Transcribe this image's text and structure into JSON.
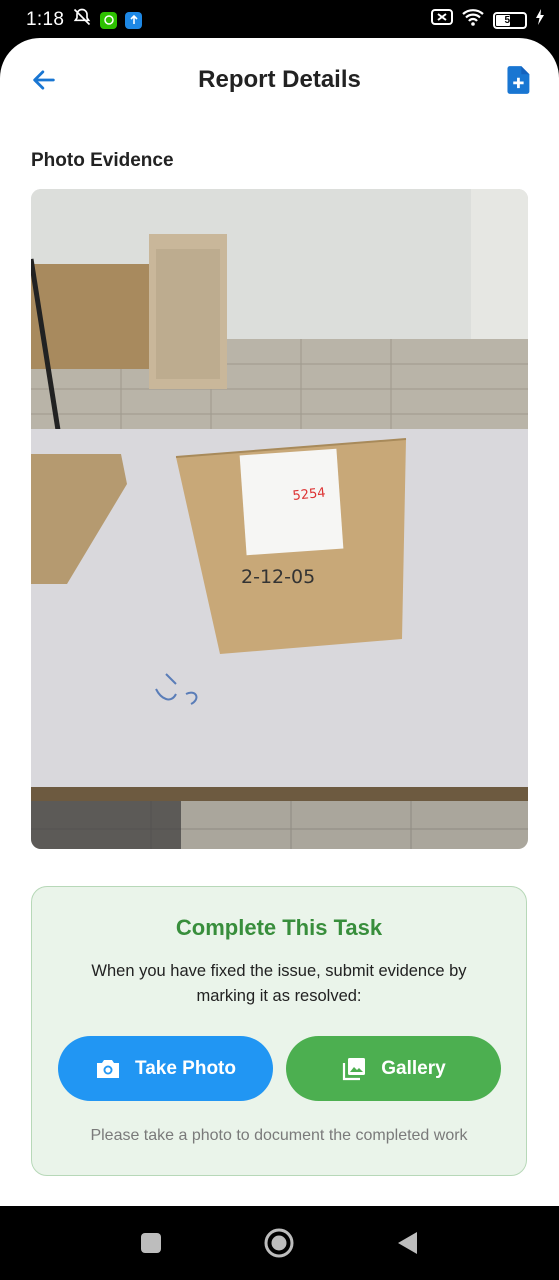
{
  "status_bar": {
    "time": "1:18",
    "battery_level": "50",
    "icons": [
      "mute-alarm-icon",
      "wechat-app-icon",
      "upload-app-icon",
      "sim-x-icon",
      "wifi-icon",
      "battery-icon",
      "charging-icon"
    ]
  },
  "header": {
    "title": "Report Details",
    "back_icon": "arrow-back-icon",
    "action_icon": "add-document-icon"
  },
  "photo_section": {
    "title": "Photo Evidence",
    "photo_label_number": "5254",
    "photo_bag_date": "2-12-05"
  },
  "task_card": {
    "title": "Complete This Task",
    "description": "When you have fixed the issue, submit evidence by marking it as resolved:",
    "take_photo_label": "Take Photo",
    "gallery_label": "Gallery",
    "hint": "Please take a photo to document the completed work"
  },
  "colors": {
    "primary_blue": "#2196f3",
    "success_green": "#4caf50",
    "title_green": "#388e3c",
    "card_background": "#eaf4ea"
  }
}
